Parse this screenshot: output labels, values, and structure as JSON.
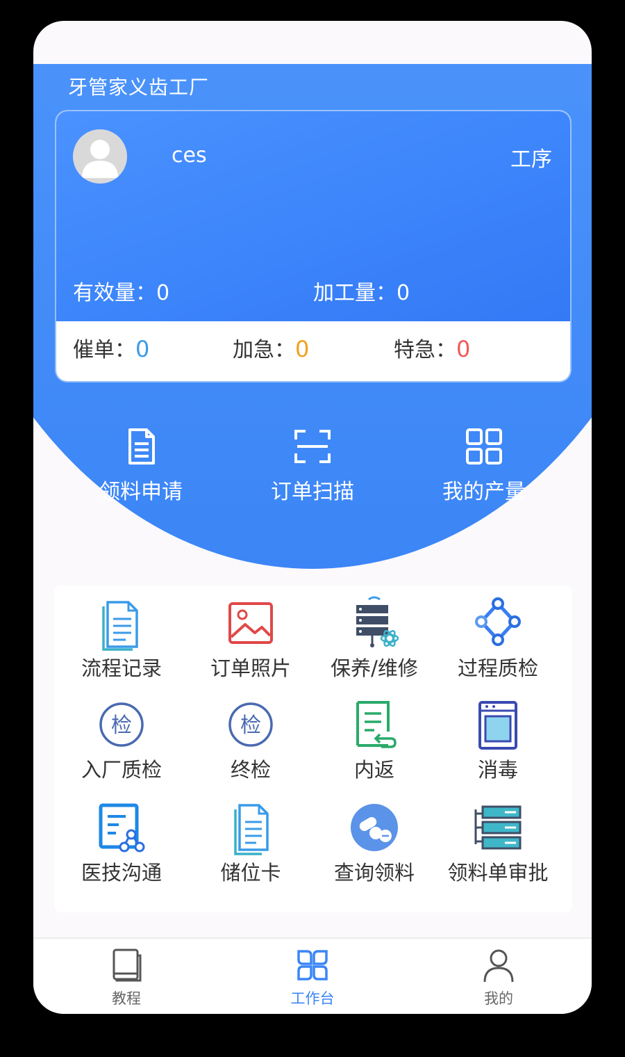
{
  "app_title": "牙管家义齿工厂",
  "user": {
    "name": "ces",
    "process_label": "工序"
  },
  "metrics": {
    "effective_label": "有效量：",
    "effective_value": "0",
    "processing_label": "加工量：",
    "processing_value": "0"
  },
  "stats": [
    {
      "label": "催单：",
      "value": "0",
      "color": "#3a9be8"
    },
    {
      "label": "加急：",
      "value": "0",
      "color": "#f0a020"
    },
    {
      "label": "特急：",
      "value": "0",
      "color": "#ee5a5a"
    }
  ],
  "quick_actions": [
    {
      "label": "领料申请",
      "icon": "document-icon"
    },
    {
      "label": "订单扫描",
      "icon": "scan-icon"
    },
    {
      "label": "我的产量",
      "icon": "grid-icon"
    }
  ],
  "features": [
    {
      "label": "流程记录",
      "icon": "copy-document-icon"
    },
    {
      "label": "订单照片",
      "icon": "image-icon"
    },
    {
      "label": "保养/维修",
      "icon": "server-maintenance-icon"
    },
    {
      "label": "过程质检",
      "icon": "cycle-icon"
    },
    {
      "label": "入厂质检",
      "icon": "inspect-badge-icon",
      "badge": "检"
    },
    {
      "label": "终检",
      "icon": "inspect-badge-icon",
      "badge": "检"
    },
    {
      "label": "内返",
      "icon": "return-document-icon"
    },
    {
      "label": "消毒",
      "icon": "sterilizer-icon"
    },
    {
      "label": "医技沟通",
      "icon": "communication-icon"
    },
    {
      "label": "储位卡",
      "icon": "storage-card-icon"
    },
    {
      "label": "查询领料",
      "icon": "pills-icon"
    },
    {
      "label": "领料单审批",
      "icon": "approval-server-icon"
    }
  ],
  "tabs": [
    {
      "label": "教程",
      "icon": "book-icon",
      "active": false
    },
    {
      "label": "工作台",
      "icon": "workbench-icon",
      "active": true
    },
    {
      "label": "我的",
      "icon": "user-icon",
      "active": false
    }
  ],
  "colors": {
    "primary": "#3b86f6",
    "primary_light": "#5aa0ff"
  }
}
